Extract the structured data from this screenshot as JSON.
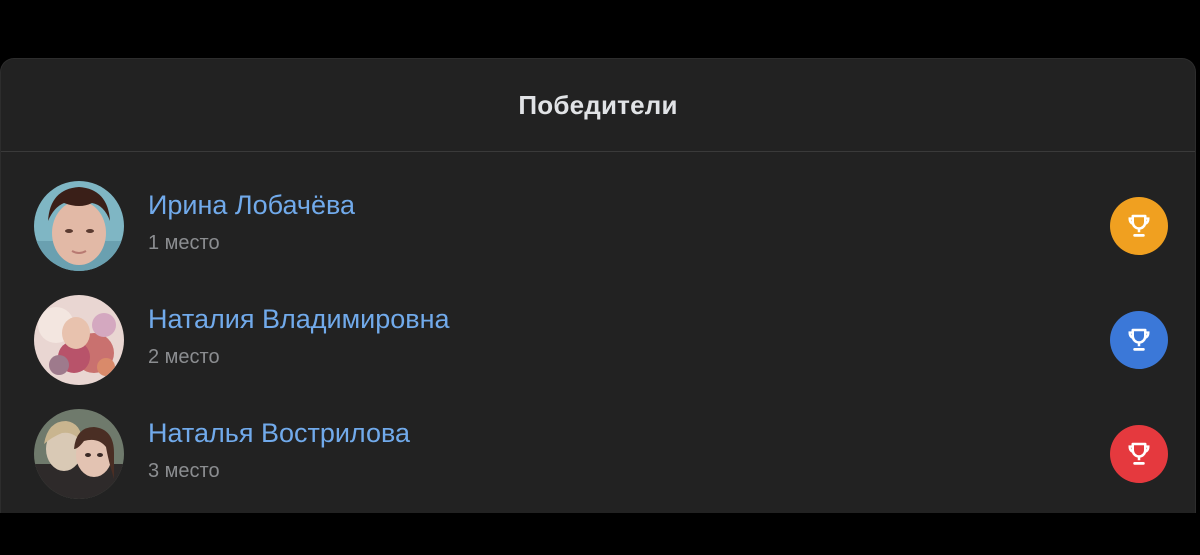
{
  "header": {
    "title": "Победители"
  },
  "winners": [
    {
      "name": "Ирина Лобачёва",
      "place": "1 место",
      "trophy_color": "#f0a020",
      "avatar_icon": "user-photo"
    },
    {
      "name": "Наталия Владимировна",
      "place": "2 место",
      "trophy_color": "#3b78d8",
      "avatar_icon": "user-photo"
    },
    {
      "name": "Наталья Вострилова",
      "place": "3 место",
      "trophy_color": "#e5393e",
      "avatar_icon": "user-photo"
    }
  ],
  "colors": {
    "background": "#000000",
    "card": "#222222",
    "name_link": "#71aaeb",
    "secondary_text": "#8b8d90"
  }
}
